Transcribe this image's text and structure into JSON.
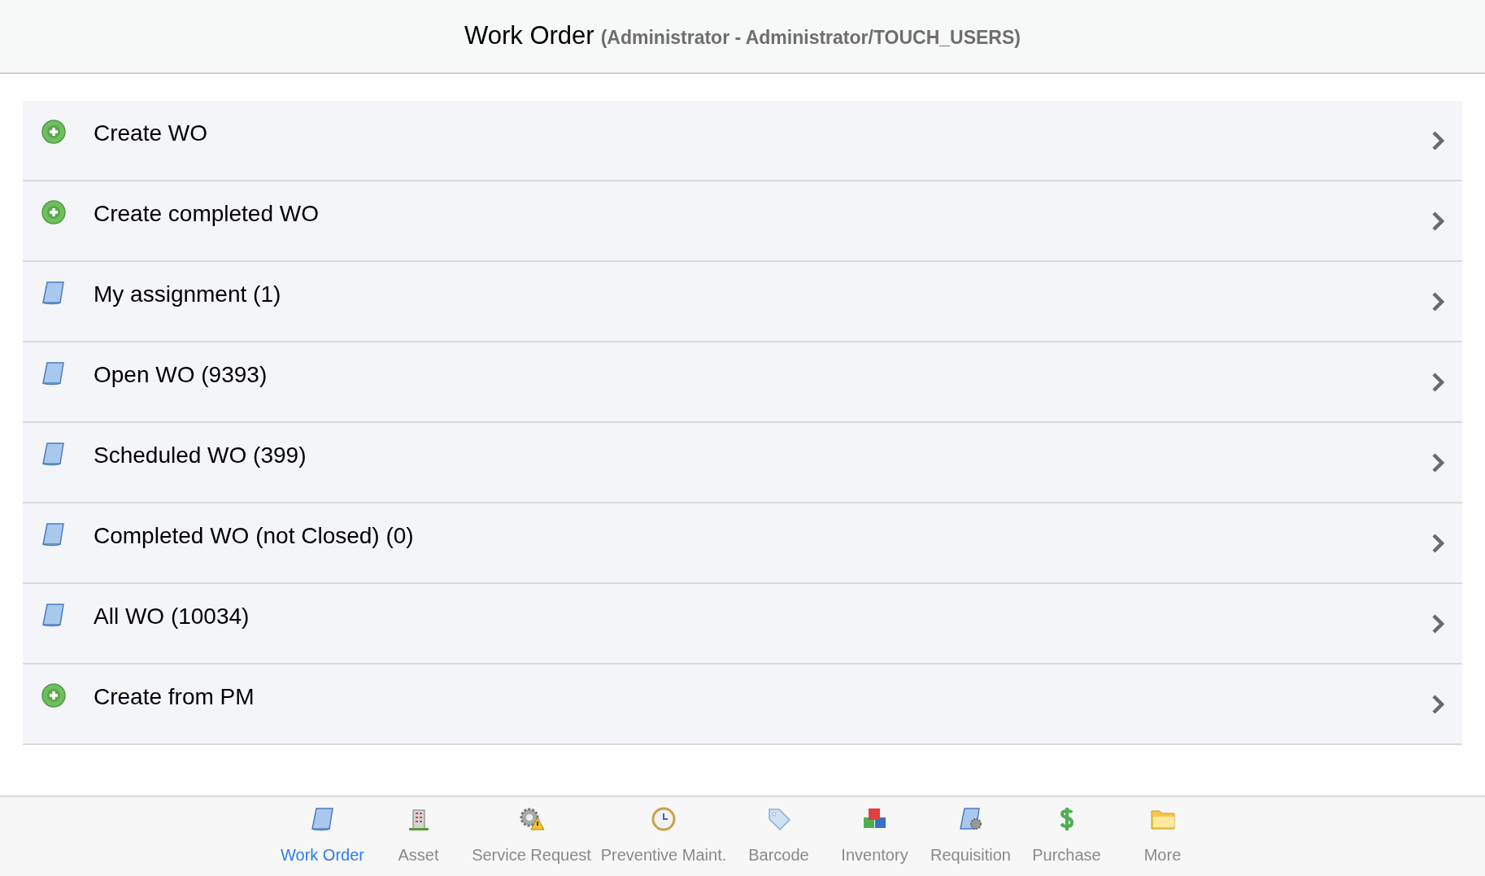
{
  "header": {
    "title": "Work Order",
    "subtitle": "(Administrator - Administrator/TOUCH_USERS)"
  },
  "menu_items": [
    {
      "label": "Create WO",
      "kind": "add"
    },
    {
      "label": "Create completed WO",
      "kind": "add"
    },
    {
      "label": "My assignment (1)",
      "kind": "list"
    },
    {
      "label": "Open WO (9393)",
      "kind": "list"
    },
    {
      "label": "Scheduled WO (399)",
      "kind": "list"
    },
    {
      "label": "Completed WO (not Closed) (0)",
      "kind": "list"
    },
    {
      "label": "All WO (10034)",
      "kind": "list"
    },
    {
      "label": "Create from PM",
      "kind": "add"
    }
  ],
  "tab_bar": [
    {
      "label": "Work Order",
      "selected": true
    },
    {
      "label": "Asset",
      "selected": false
    },
    {
      "label": "Service Request",
      "selected": false
    },
    {
      "label": "Preventive Maint.",
      "selected": false
    },
    {
      "label": "Barcode",
      "selected": false
    },
    {
      "label": "Inventory",
      "selected": false
    },
    {
      "label": "Requisition",
      "selected": false
    },
    {
      "label": "Purchase",
      "selected": false
    },
    {
      "label": "More",
      "selected": false
    }
  ]
}
